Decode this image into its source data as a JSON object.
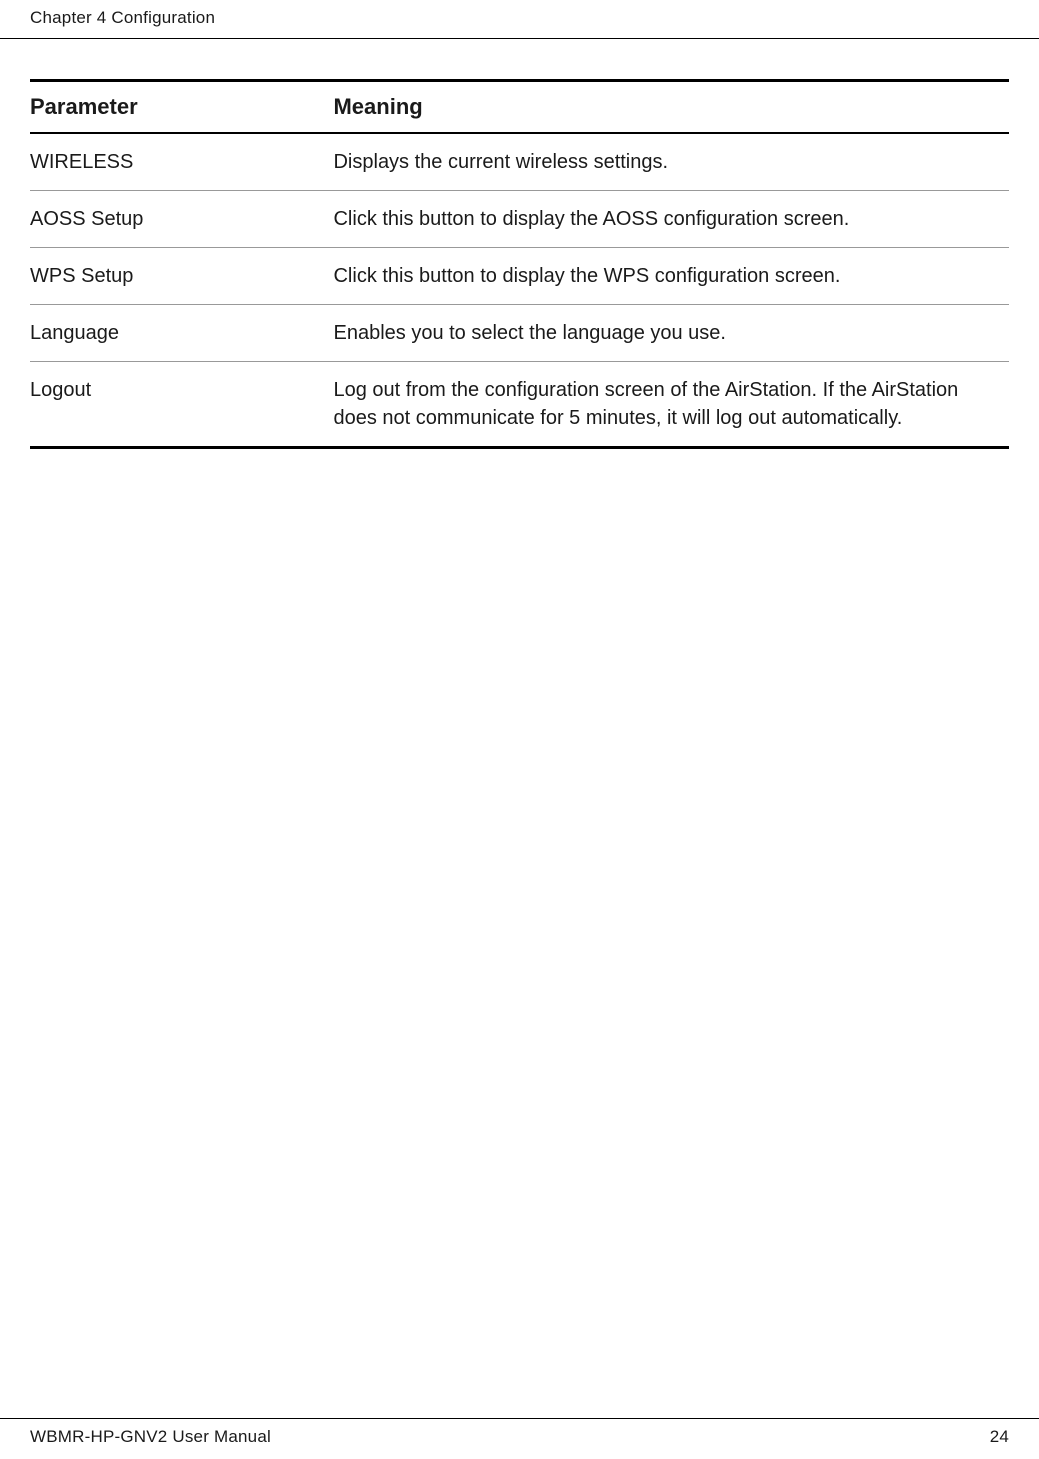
{
  "header": {
    "chapter_label": "Chapter 4  Configuration"
  },
  "table": {
    "headers": {
      "parameter": "Parameter",
      "meaning": "Meaning"
    },
    "rows": [
      {
        "parameter": "WIRELESS",
        "meaning": "Displays the current wireless settings."
      },
      {
        "parameter": "AOSS Setup",
        "meaning": "Click this button to display the AOSS configuration screen."
      },
      {
        "parameter": "WPS Setup",
        "meaning": "Click this button to display the WPS configuration screen."
      },
      {
        "parameter": "Language",
        "meaning": "Enables you to select the language you use."
      },
      {
        "parameter": "Logout",
        "meaning": "Log out from the configuration screen of the AirStation. If the AirStation does not communicate for 5 minutes, it will log out automatically."
      }
    ]
  },
  "footer": {
    "manual_title": "WBMR-HP-GNV2 User Manual",
    "page_number": "24"
  }
}
